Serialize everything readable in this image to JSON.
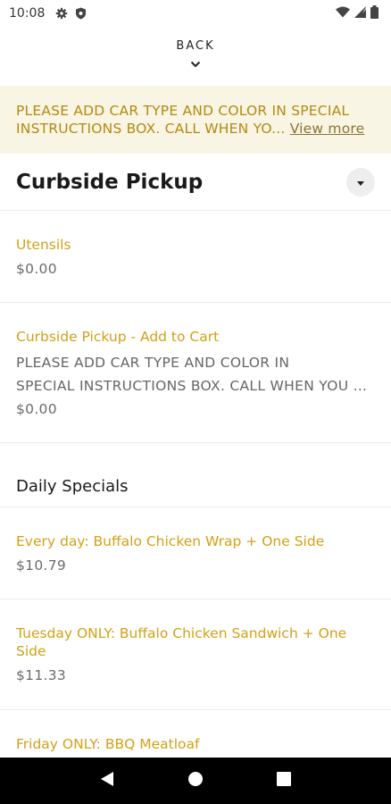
{
  "status_bar": {
    "time": "10:08",
    "icons": [
      "gear-icon",
      "shield-icon",
      "wifi-icon",
      "signal-icon",
      "battery-icon"
    ]
  },
  "back": {
    "label": "BACK"
  },
  "banner": {
    "text": "PLEASE ADD CAR TYPE AND COLOR IN SPECIAL INSTRUCTIONS BOX. CALL WHEN YO...",
    "more": "View more"
  },
  "section": {
    "title": "Curbside Pickup"
  },
  "items": [
    {
      "name": "Utensils",
      "price": "$0.00"
    },
    {
      "name": "Curbside Pickup - Add to Cart",
      "desc_line1": "PLEASE ADD CAR TYPE AND COLOR IN",
      "desc_line2": "SPECIAL INSTRUCTIONS BOX. CALL WHEN YOU ...",
      "price": "$0.00"
    }
  ],
  "subsection": {
    "title": "Daily Specials"
  },
  "specials": [
    {
      "name": "Every day: Buffalo Chicken Wrap + One Side",
      "price": "$10.79"
    },
    {
      "name": "Tuesday ONLY: Buffalo Chicken Sandwich + One Side",
      "price": "$11.33"
    },
    {
      "name": "Friday ONLY: BBQ Meatloaf"
    }
  ],
  "colors": {
    "accent": "#d4a017",
    "banner_bg": "#f8f5e4",
    "banner_text": "#b48a11"
  }
}
